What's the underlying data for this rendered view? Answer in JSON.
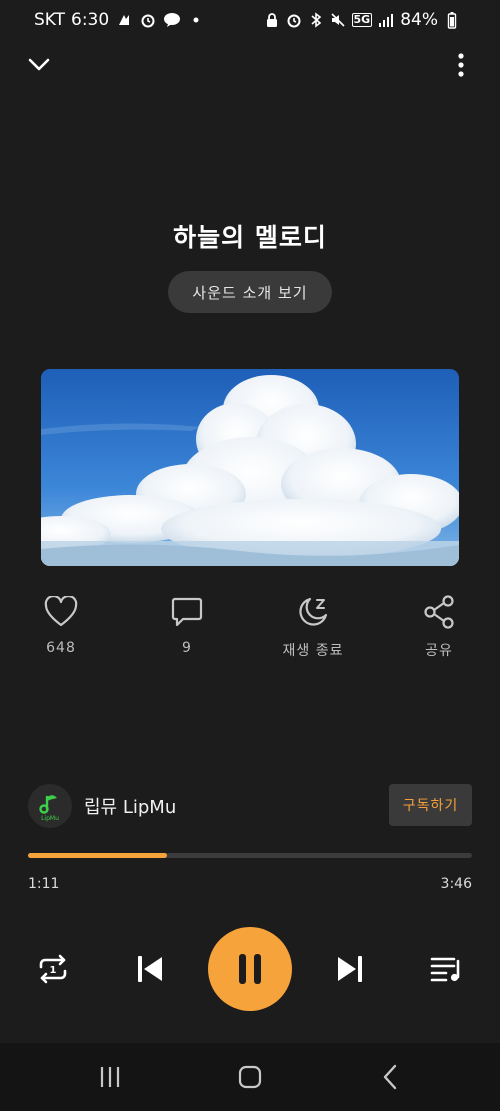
{
  "status_bar": {
    "carrier": "SKT",
    "time": "6:30",
    "network": "5G",
    "battery": "84%",
    "icons_left": [
      "gallery-icon",
      "alarm-icon",
      "talk-icon",
      "dot-icon"
    ],
    "icons_right": [
      "lock-icon",
      "alarm-icon",
      "bluetooth-icon",
      "mute-icon",
      "network-5g-icon",
      "signal-icon",
      "battery-icon"
    ]
  },
  "top_bar": {
    "collapse_icon": "chevron-down-icon",
    "more_icon": "more-vertical-icon"
  },
  "track": {
    "title": "하늘의 멜로디",
    "intro_button_label": "사운드 소개 보기"
  },
  "actions": {
    "like": {
      "icon": "heart-icon",
      "label": "648"
    },
    "comment": {
      "icon": "comment-icon",
      "label": "9"
    },
    "sleep": {
      "icon": "sleep-timer-icon",
      "label": "재생 종료"
    },
    "share": {
      "icon": "share-icon",
      "label": "공유"
    }
  },
  "channel": {
    "name": "립뮤 LipMu",
    "avatar_text": "LipMu",
    "subscribe_label": "구독하기"
  },
  "playback": {
    "current_time": "1:11",
    "total_time": "3:46",
    "progress_fraction": 0.314,
    "repeat_badge": "1"
  },
  "colors": {
    "background": "#1c1c1c",
    "accent": "#f5a33a",
    "button_bg": "#3a3a3a",
    "channel_green": "#3ecf4a"
  }
}
